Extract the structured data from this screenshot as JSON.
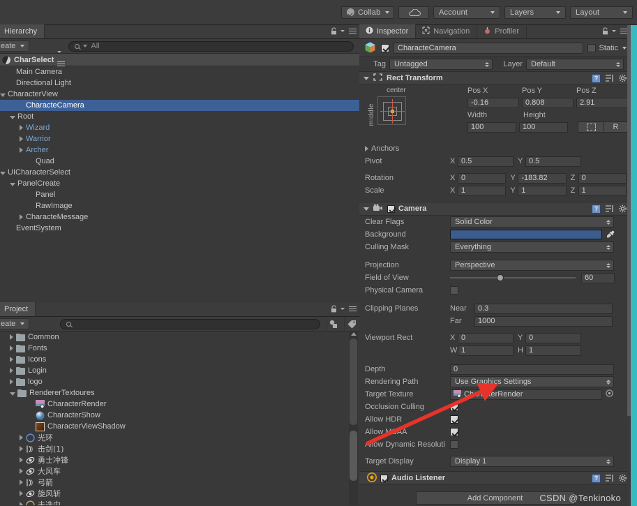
{
  "toolbar": {
    "collab": "Collab",
    "cloud_icon": "cloud-icon",
    "account": "Account",
    "layers": "Layers",
    "layout": "Layout"
  },
  "hierarchy": {
    "tab": "Hierarchy",
    "create_button": "eate",
    "search_placeholder": "All",
    "scene_name": "CharSelect",
    "items": [
      {
        "label": "Main Camera",
        "indent": 1,
        "arrow": "none",
        "prefab": false,
        "selected": false
      },
      {
        "label": "Directional Light",
        "indent": 1,
        "arrow": "none",
        "prefab": false,
        "selected": false
      },
      {
        "label": "CharacterView",
        "indent": 0,
        "arrow": "open",
        "prefab": false,
        "selected": false
      },
      {
        "label": "CharacteCamera",
        "indent": 2,
        "arrow": "none",
        "prefab": false,
        "selected": true
      },
      {
        "label": "Root",
        "indent": 1,
        "arrow": "open",
        "prefab": false,
        "selected": false
      },
      {
        "label": "Wizard",
        "indent": 2,
        "arrow": "closed",
        "prefab": true,
        "selected": false
      },
      {
        "label": "Warrior",
        "indent": 2,
        "arrow": "closed",
        "prefab": true,
        "selected": false
      },
      {
        "label": "Archer",
        "indent": 2,
        "arrow": "closed",
        "prefab": true,
        "selected": false
      },
      {
        "label": "Quad",
        "indent": 3,
        "arrow": "none",
        "prefab": false,
        "selected": false
      },
      {
        "label": "UICharacterSelect",
        "indent": 0,
        "arrow": "open",
        "prefab": false,
        "selected": false
      },
      {
        "label": "PanelCreate",
        "indent": 1,
        "arrow": "open",
        "prefab": false,
        "selected": false
      },
      {
        "label": "Panel",
        "indent": 3,
        "arrow": "none",
        "prefab": false,
        "selected": false
      },
      {
        "label": "RawImage",
        "indent": 3,
        "arrow": "none",
        "prefab": false,
        "selected": false
      },
      {
        "label": "CharacteMessage",
        "indent": 2,
        "arrow": "closed",
        "prefab": false,
        "selected": false
      },
      {
        "label": "EventSystem",
        "indent": 1,
        "arrow": "none",
        "prefab": false,
        "selected": false
      }
    ]
  },
  "project": {
    "tab": "Project",
    "create_button": "eate",
    "search_placeholder": "",
    "items": [
      {
        "label": "Common",
        "indent": 1,
        "arrow": "closed",
        "type": "folder"
      },
      {
        "label": "Fonts",
        "indent": 1,
        "arrow": "closed",
        "type": "folder"
      },
      {
        "label": "Icons",
        "indent": 1,
        "arrow": "closed",
        "type": "folder"
      },
      {
        "label": "Login",
        "indent": 1,
        "arrow": "closed",
        "type": "folder"
      },
      {
        "label": "logo",
        "indent": 1,
        "arrow": "closed",
        "type": "folder"
      },
      {
        "label": "RendererTextoures",
        "indent": 1,
        "arrow": "open",
        "type": "folder"
      },
      {
        "label": "CharacterRender",
        "indent": 3,
        "arrow": "none",
        "type": "rendertexture"
      },
      {
        "label": "CharacterShow",
        "indent": 3,
        "arrow": "none",
        "type": "material"
      },
      {
        "label": "CharacterViewShadow",
        "indent": 3,
        "arrow": "none",
        "type": "texture"
      },
      {
        "label": "光环",
        "indent": 2,
        "arrow": "closed",
        "type": "prefab-circle"
      },
      {
        "label": "击剑(1)",
        "indent": 2,
        "arrow": "closed",
        "type": "anim"
      },
      {
        "label": "勇士冲锋",
        "indent": 2,
        "arrow": "closed",
        "type": "anim2"
      },
      {
        "label": "大风车",
        "indent": 2,
        "arrow": "closed",
        "type": "anim2"
      },
      {
        "label": "弓箭",
        "indent": 2,
        "arrow": "closed",
        "type": "anim"
      },
      {
        "label": "旋风斩",
        "indent": 2,
        "arrow": "closed",
        "type": "anim2"
      },
      {
        "label": "未选中",
        "indent": 2,
        "arrow": "closed",
        "type": "prefab-circle2"
      }
    ]
  },
  "inspector": {
    "tabs": [
      {
        "label": "Inspector",
        "icon": "info-icon",
        "active": true
      },
      {
        "label": "Navigation",
        "icon": "navigation-icon",
        "active": false
      },
      {
        "label": "Profiler",
        "icon": "profiler-icon",
        "active": false
      }
    ],
    "object_name": "CharacteCamera",
    "object_enabled": true,
    "static_label": "Static",
    "static_checked": false,
    "tag_label": "Tag",
    "tag_value": "Untagged",
    "layer_label": "Layer",
    "layer_value": "Default",
    "rect_transform": {
      "title": "Rect Transform",
      "anchor_horizontal": "center",
      "anchor_vertical": "middle",
      "pos_x_label": "Pos X",
      "pos_x": "-0.16",
      "pos_y_label": "Pos Y",
      "pos_y": "0.808",
      "pos_z_label": "Pos Z",
      "pos_z": "2.91",
      "width_label": "Width",
      "width": "100",
      "height_label": "Height",
      "height": "100",
      "raw_button": "R",
      "anchors_label": "Anchors",
      "pivot_label": "Pivot",
      "pivot_x": "0.5",
      "pivot_y": "0.5",
      "rotation_label": "Rotation",
      "rot_x": "0",
      "rot_y": "-183.82",
      "rot_z": "0",
      "scale_label": "Scale",
      "scale_x": "1",
      "scale_y": "1",
      "scale_z": "1"
    },
    "camera": {
      "title": "Camera",
      "enabled": true,
      "clear_flags_label": "Clear Flags",
      "clear_flags": "Solid Color",
      "background_label": "Background",
      "background_color": "#3d5b8c",
      "culling_mask_label": "Culling Mask",
      "culling_mask": "Everything",
      "projection_label": "Projection",
      "projection": "Perspective",
      "fov_label": "Field of View",
      "fov": "60",
      "physical_camera_label": "Physical Camera",
      "physical_camera": false,
      "clipping_label": "Clipping Planes",
      "near_label": "Near",
      "near": "0.3",
      "far_label": "Far",
      "far": "1000",
      "viewport_label": "Viewport Rect",
      "viewport_x": "0",
      "viewport_y": "0",
      "viewport_w": "1",
      "viewport_h": "1",
      "depth_label": "Depth",
      "depth": "0",
      "rendering_path_label": "Rendering Path",
      "rendering_path": "Use Graphics Settings",
      "target_texture_label": "Target Texture",
      "target_texture": "CharacterRender",
      "occlusion_label": "Occlusion Culling",
      "occlusion": true,
      "hdr_label": "Allow HDR",
      "hdr": true,
      "msaa_label": "Allow MSAA",
      "msaa": true,
      "dynres_label": "Allow Dynamic Resoluti",
      "dynres": false,
      "target_display_label": "Target Display",
      "target_display": "Display 1"
    },
    "audio_listener": {
      "title": "Audio Listener",
      "enabled": true
    },
    "add_component": "Add Component"
  },
  "watermark": "CSDN @Tenkinoko",
  "annotation": {
    "type": "red-arrow",
    "color": "#e8332a"
  }
}
